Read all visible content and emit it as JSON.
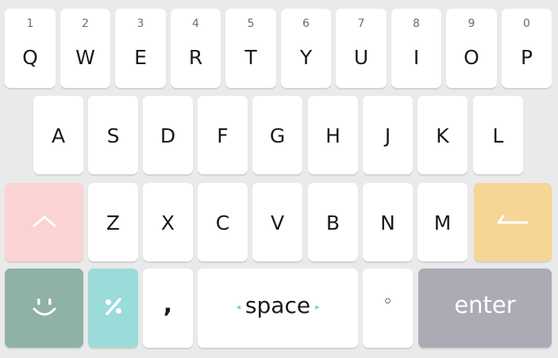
{
  "keyboard": {
    "row1": [
      {
        "hint": "1",
        "label": "Q"
      },
      {
        "hint": "2",
        "label": "W"
      },
      {
        "hint": "3",
        "label": "E"
      },
      {
        "hint": "4",
        "label": "R"
      },
      {
        "hint": "5",
        "label": "T"
      },
      {
        "hint": "6",
        "label": "Y"
      },
      {
        "hint": "7",
        "label": "U"
      },
      {
        "hint": "8",
        "label": "I"
      },
      {
        "hint": "9",
        "label": "O"
      },
      {
        "hint": "0",
        "label": "P"
      }
    ],
    "row2": [
      "A",
      "S",
      "D",
      "F",
      "G",
      "H",
      "J",
      "K",
      "L"
    ],
    "row3": [
      "Z",
      "X",
      "C",
      "V",
      "B",
      "N",
      "M"
    ],
    "bottom": {
      "comma": ",",
      "space": "space",
      "space_left_arrow": "◂",
      "space_right_arrow": "▸",
      "period": "◦",
      "enter": "enter"
    },
    "icons": {
      "shift": "chevron-up-icon",
      "backspace": "backspace-icon",
      "emoji": "smiley-icon",
      "symbols": "percent-icon"
    },
    "colors": {
      "background": "#e9eae9",
      "key": "#ffffff",
      "shift": "#fbd3d3",
      "backspace": "#f5d695",
      "emoji": "#8fb1a6",
      "symbols": "#9bdbda",
      "enter": "#ababb6"
    }
  }
}
